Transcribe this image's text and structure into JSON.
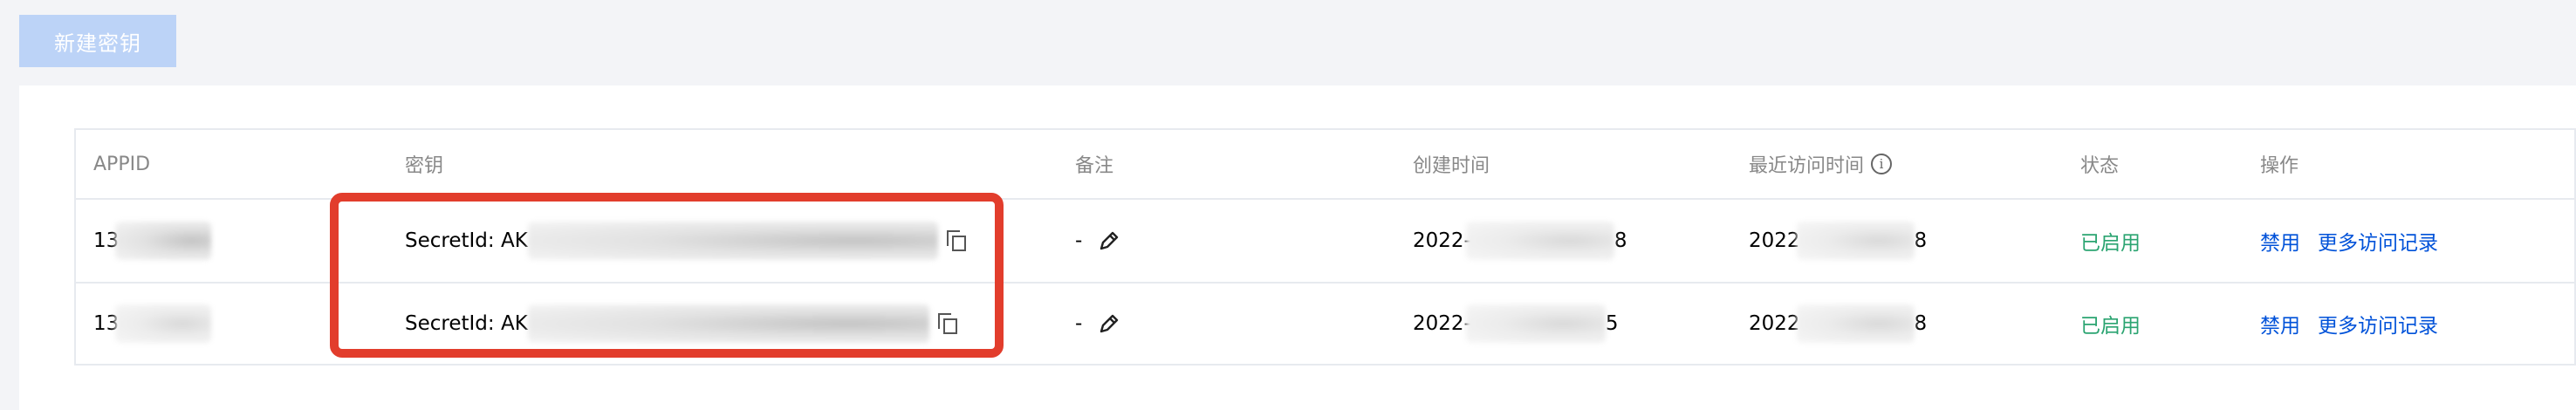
{
  "toolbar": {
    "new_key_label": "新建密钥"
  },
  "table": {
    "headers": {
      "appid": "APPID",
      "key": "密钥",
      "remark": "备注",
      "created": "创建时间",
      "last_access": "最近访问时间",
      "status": "状态",
      "ops": "操作"
    },
    "info_icon": "i",
    "rows": [
      {
        "appid_prefix": "13",
        "secret_label": "SecretId: AK",
        "remark": "-",
        "created_prefix": "2022-",
        "created_suffix": "8",
        "access_prefix": "2022",
        "access_suffix": "8",
        "status": "已启用",
        "action_disable": "禁用",
        "action_more": "更多访问记录"
      },
      {
        "appid_prefix": "13",
        "secret_label": "SecretId: AK",
        "remark": "-",
        "created_prefix": "2022-",
        "created_suffix": "5",
        "access_prefix": "2022",
        "access_suffix": "8",
        "status": "已启用",
        "action_disable": "禁用",
        "action_more": "更多访问记录"
      }
    ]
  },
  "colors": {
    "primary_disabled": "#bcd3f7",
    "status_ok": "#2ba471",
    "link": "#0052d9",
    "highlight": "#e23d2c"
  }
}
